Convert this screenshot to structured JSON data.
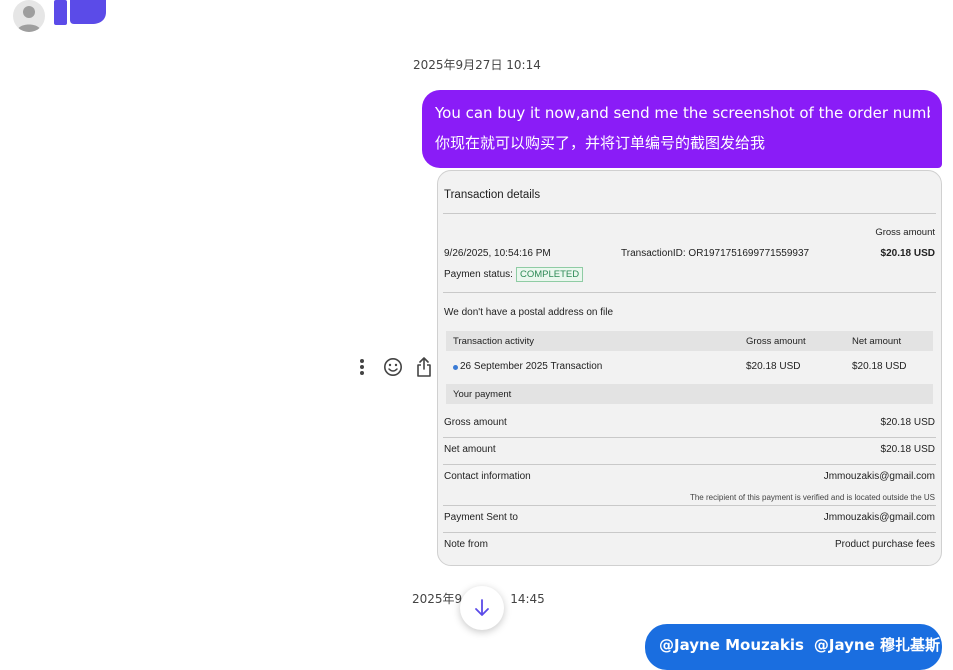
{
  "sender": {
    "avatar_icon": "person-icon",
    "reaction_icon": "thumbs-up-icon",
    "reaction_color": "#5b4be8"
  },
  "messages": {
    "timestamp_1": "2025年9月27日 10:14",
    "purple_message": {
      "line_1": "You can buy it now,and send me the screenshot of the order numbe",
      "line_2": "你现在就可以购买了，并将订单编号的截图发给我",
      "color": "#8a1cf7"
    },
    "timestamp_2": "2025年9",
    "timestamp_2_tail": "14:45",
    "blue_message": {
      "mention_1": "@Jayne Mouzakis",
      "mention_2": "@Jayne 穆扎基斯",
      "color": "#1a6ee0"
    }
  },
  "actions": {
    "more_icon": "more-vertical-icon",
    "react_icon": "emoji-icon",
    "share_icon": "share-icon"
  },
  "screenshot": {
    "title": "Transaction details",
    "gross_amount_header": "Gross amount",
    "date_time": "9/26/2025, 10:54:16 PM",
    "transaction_id": "TransactionID: OR1971751699771559937",
    "gross_amount_top": "$20.18 USD",
    "payment_status_label": "Paymen status:",
    "payment_status": "COMPLETED",
    "postal_note": "We don't have a postal address on file",
    "activity_table": {
      "headers": [
        "Transaction activity",
        "Gross amount",
        "Net amount"
      ],
      "row": [
        "26 September 2025 Transaction",
        "$20.18 USD",
        "$20.18 USD"
      ]
    },
    "your_payment": "Your payment",
    "gross_amount_label": "Gross amount",
    "gross_amount_value": "$20.18 USD",
    "net_amount_label": "Net amount",
    "net_amount_value": "$20.18 USD",
    "contact_label": "Contact information",
    "contact_value": "Jmmouzakis@gmail.com",
    "recipient_note": "The recipient of this payment is verified and is located outside the US",
    "sent_to_label": "Payment Sent to",
    "sent_to_value": "Jmmouzakis@gmail.com",
    "note_label": "Note from",
    "note_value": "Product purchase fees"
  },
  "scroll_down_icon": "arrow-down-icon",
  "scroll_down_color": "#5b4be8"
}
